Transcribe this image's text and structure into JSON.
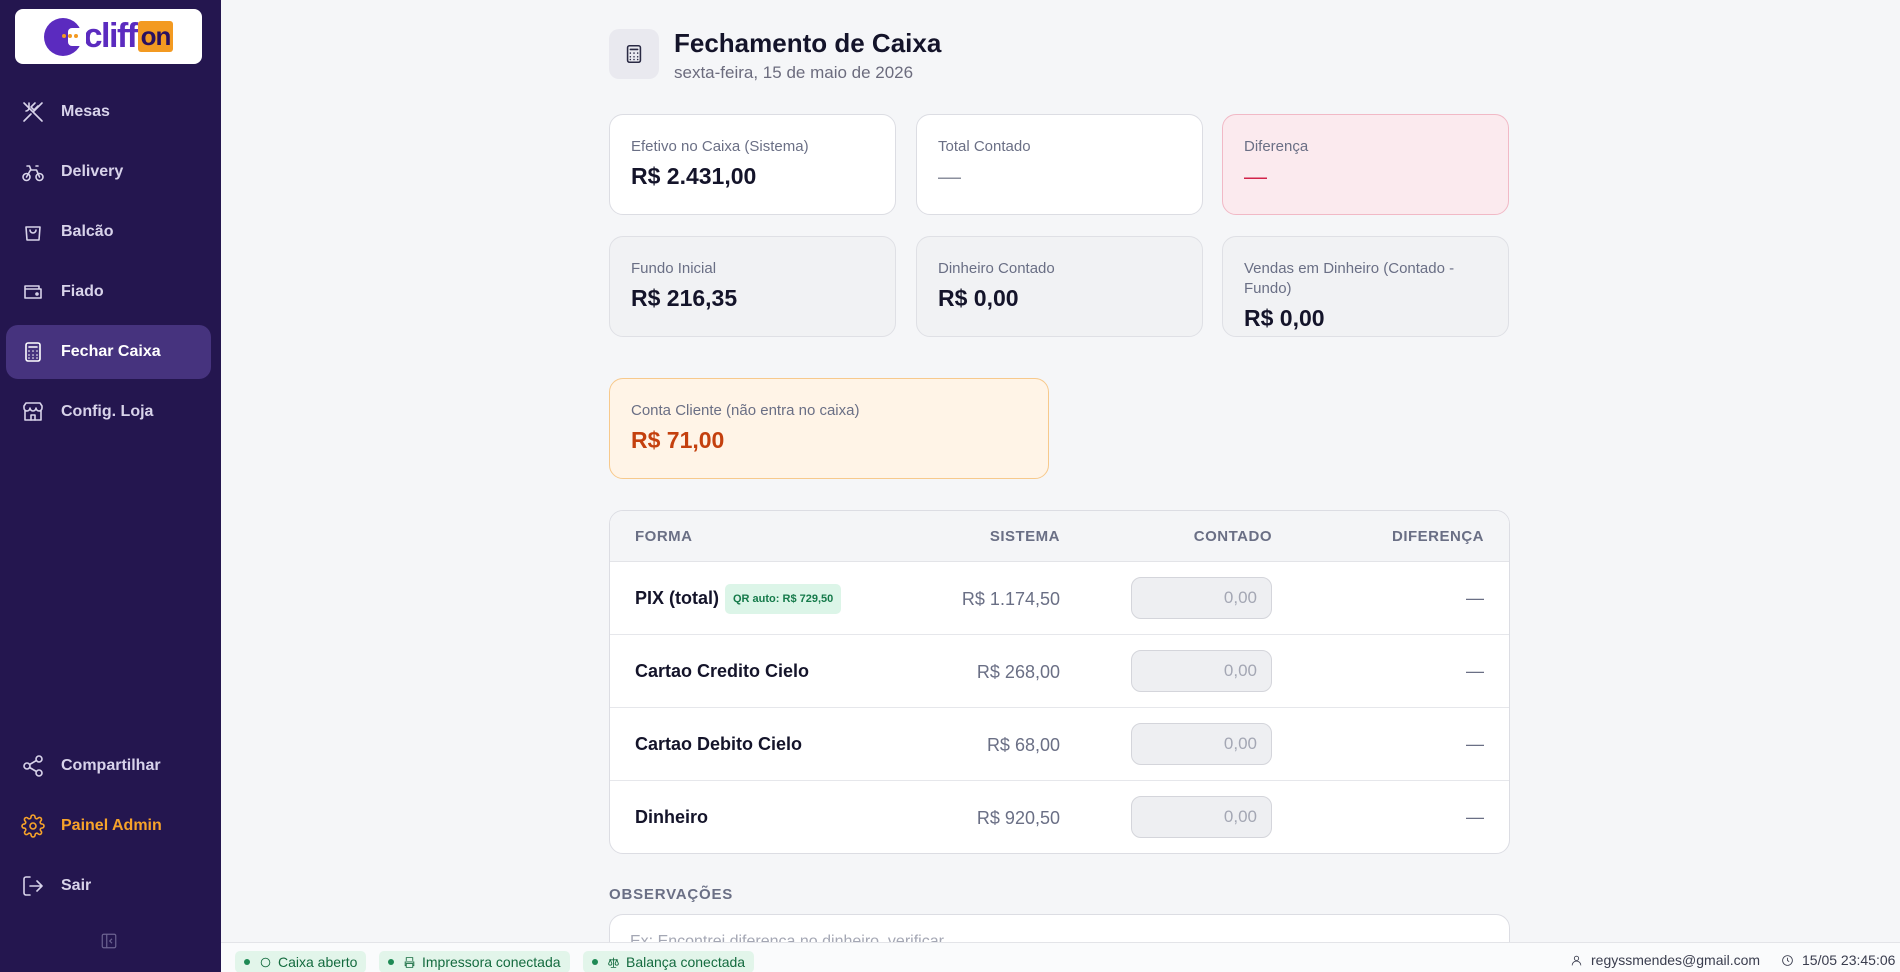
{
  "brand": {
    "logo_text": "cliff",
    "logo_suffix": "on"
  },
  "sidebar": {
    "items": [
      {
        "label": "Mesas",
        "icon": "utensils-icon"
      },
      {
        "label": "Delivery",
        "icon": "bicycle-icon"
      },
      {
        "label": "Balcão",
        "icon": "shopping-bag-icon"
      },
      {
        "label": "Fiado",
        "icon": "wallet-icon"
      },
      {
        "label": "Fechar Caixa",
        "icon": "calculator-icon",
        "active": true
      },
      {
        "label": "Config. Loja",
        "icon": "store-icon"
      }
    ],
    "bottom": [
      {
        "label": "Compartilhar",
        "icon": "share-icon"
      },
      {
        "label": "Painel Admin",
        "icon": "gear-icon"
      },
      {
        "label": "Sair",
        "icon": "logout-icon"
      }
    ]
  },
  "header": {
    "title": "Fechamento de Caixa",
    "date": "sexta-feira, 15 de maio de 2026"
  },
  "summary": {
    "efetivo_label": "Efetivo no Caixa (Sistema)",
    "efetivo_value": "R$ 2.431,00",
    "total_contado_label": "Total Contado",
    "total_contado_value": "—",
    "diferenca_label": "Diferença",
    "diferenca_value": "—",
    "fundo_label": "Fundo Inicial",
    "fundo_value": "R$ 216,35",
    "dinheiro_contado_label": "Dinheiro Contado",
    "dinheiro_contado_value": "R$ 0,00",
    "vendas_dinheiro_label": "Vendas em Dinheiro (Contado - Fundo)",
    "vendas_dinheiro_value": "R$ 0,00",
    "conta_cliente_label": "Conta Cliente (não entra no caixa)",
    "conta_cliente_value": "R$ 71,00"
  },
  "table": {
    "headers": {
      "forma": "FORMA",
      "sistema": "SISTEMA",
      "contado": "CONTADO",
      "diferenca": "DIFERENÇA"
    },
    "rows": [
      {
        "forma": "PIX (total)",
        "badge": "QR auto: R$ 729,50",
        "sistema": "R$ 1.174,50",
        "contado_placeholder": "0,00",
        "diferenca": "—"
      },
      {
        "forma": "Cartao Credito Cielo",
        "sistema": "R$ 268,00",
        "contado_placeholder": "0,00",
        "diferenca": "—"
      },
      {
        "forma": "Cartao Debito Cielo",
        "sistema": "R$ 68,00",
        "contado_placeholder": "0,00",
        "diferenca": "—"
      },
      {
        "forma": "Dinheiro",
        "sistema": "R$ 920,50",
        "contado_placeholder": "0,00",
        "diferenca": "—"
      }
    ]
  },
  "observacoes": {
    "label": "OBSERVAÇÕES",
    "placeholder": "Ex: Encontrei diferença no dinheiro, verificar..."
  },
  "statusbar": {
    "caixa": "Caixa aberto",
    "impressora": "Impressora conectada",
    "balanca": "Balança conectada",
    "user": "regyssmendes@gmail.com",
    "datetime": "15/05 23:45:06"
  },
  "colors": {
    "sidebar_bg": "#24164f",
    "active_item": "#46337e",
    "admin_accent": "#f7a32a",
    "brand_purple": "#5b2bbf",
    "brand_orange": "#f39a21",
    "status_green": "#146b3f"
  }
}
